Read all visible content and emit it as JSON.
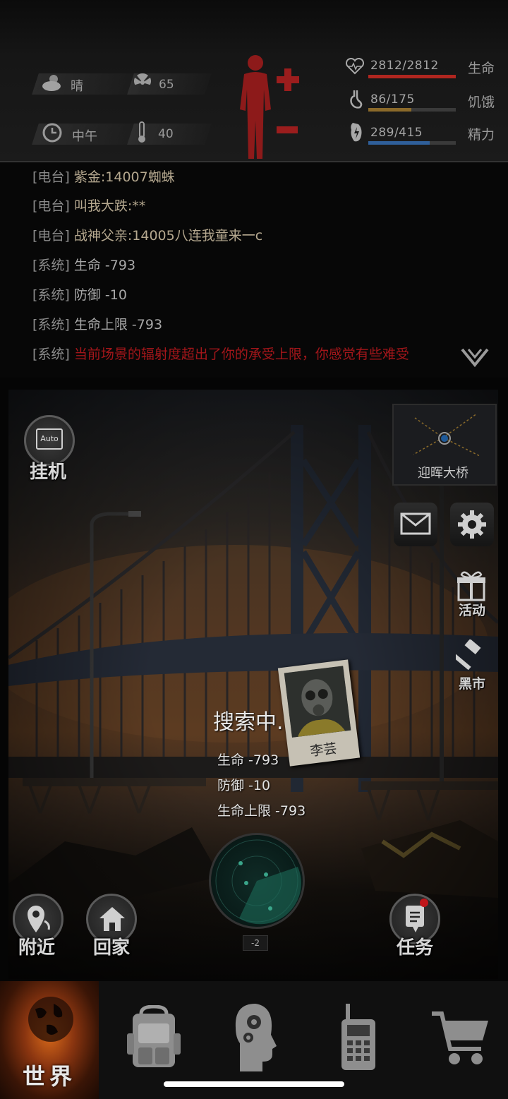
{
  "status": {
    "weather": {
      "icon": "cloud-icon",
      "label": "晴"
    },
    "radiation": {
      "icon": "radiation-icon",
      "value": "65"
    },
    "time": {
      "icon": "clock-icon",
      "label": "中午"
    },
    "temperature": {
      "icon": "thermometer-icon",
      "value": "40"
    },
    "health": {
      "label": "生命",
      "value": "2812/2812",
      "fill": 1.0,
      "color": "#b0261f"
    },
    "hunger": {
      "label": "饥饿",
      "value": "86/175",
      "fill": 0.49,
      "color": "#8b6a2a"
    },
    "energy": {
      "label": "精力",
      "value": "289/415",
      "fill": 0.7,
      "color": "#2f5f9a"
    }
  },
  "chat": [
    {
      "tag": "[电台]",
      "msg": "紫金:14007蜘蛛",
      "kind": "radio"
    },
    {
      "tag": "[电台]",
      "msg": "叫我大跌:**",
      "kind": "radio"
    },
    {
      "tag": "[电台]",
      "msg": "战神父亲:14005八连我童来一c",
      "kind": "radio"
    },
    {
      "tag": "[系统]",
      "msg": "生命 -793",
      "kind": "system"
    },
    {
      "tag": "[系统]",
      "msg": "防御 -10",
      "kind": "system"
    },
    {
      "tag": "[系统]",
      "msg": "生命上限 -793",
      "kind": "system"
    },
    {
      "tag": "[系统]",
      "msg": "当前场景的辐射度超出了你的承受上限，你感觉有些难受",
      "kind": "alert"
    }
  ],
  "scene": {
    "auto_label": "Auto",
    "auto_button": "挂机",
    "location": "迎晖大桥",
    "event_label": "活动",
    "market_label": "黑市",
    "searching": "搜索中...",
    "effects": [
      "生命 -793",
      "防御 -10",
      "生命上限 -793"
    ],
    "npc_name": "李芸",
    "radar_count": "-2",
    "nearby": "附近",
    "home": "回家",
    "quests": "任务"
  },
  "nav": {
    "world": "世界"
  }
}
